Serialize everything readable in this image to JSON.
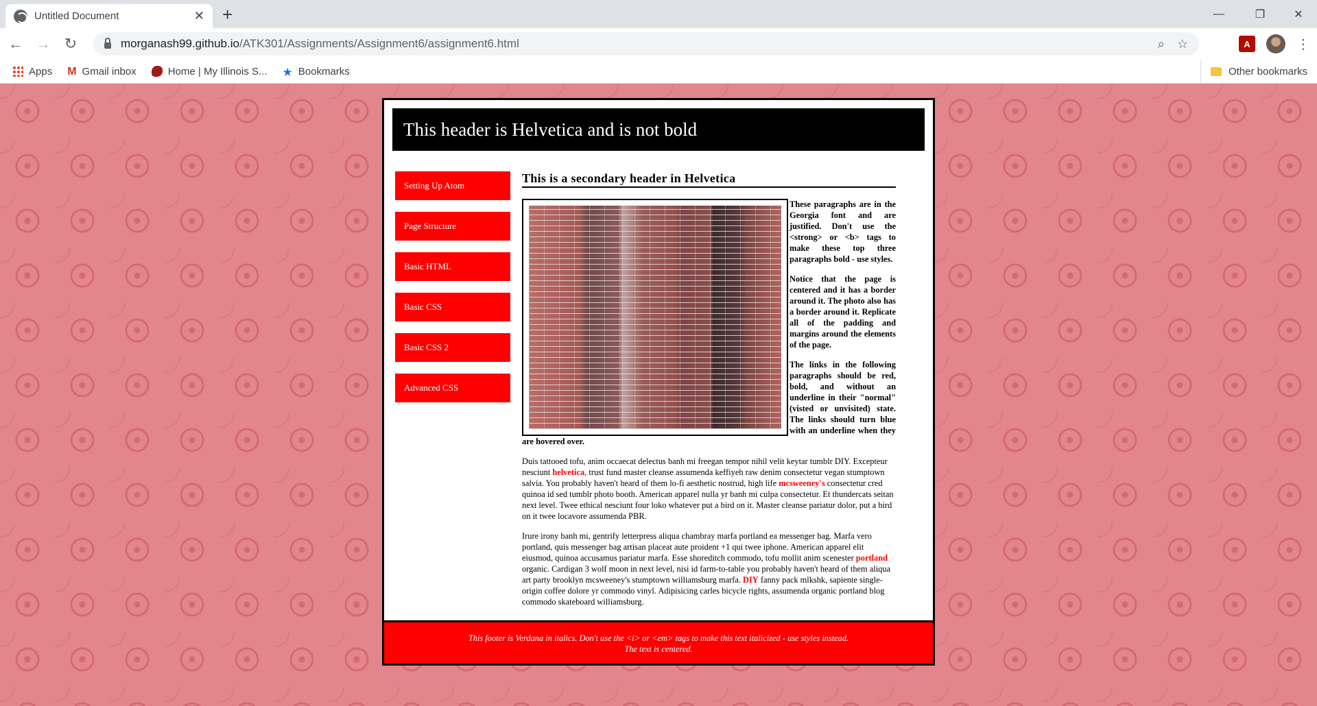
{
  "browser": {
    "tab_title": "Untitled Document",
    "tab_close": "✕",
    "new_tab": "+",
    "url_host": "morganash99.github.io",
    "url_path": "/ATK301/Assignments/Assignment6/assignment6.html",
    "window_minimize": "—",
    "window_restore": "❐",
    "window_close": "✕",
    "back": "←",
    "forward": "→",
    "reload": "↻",
    "zoom": "⌕",
    "star": "☆",
    "menu": "⋮",
    "pdf_label": "A"
  },
  "bookmarks": {
    "items": [
      "Apps",
      "Gmail inbox",
      "Home | My Illinois S...",
      "Bookmarks"
    ],
    "gmail_glyph": "M",
    "star_glyph": "★",
    "other": "Other bookmarks"
  },
  "page": {
    "header": "This header is Helvetica and is not bold",
    "nav": [
      "Setting Up Atom",
      "Page Structure",
      "Basic HTML",
      "Basic CSS",
      "Basic CSS 2",
      "Advanced CSS"
    ],
    "subheader": "This is a secondary header in Helvetica",
    "bold_paragraphs": [
      "These paragraphs are in the Georgia font and are justified. Don't use the <strong> or <b> tags to make these top three paragraphs bold - use styles.",
      "Notice that the page is centered and it has a border around it. The photo also has a border around it. Replicate all of the padding and margins around the elements of the page.",
      "The links in the following paragraphs should be red, bold, and without an underline in their \"normal\" (visted or unvisited) state. The links should turn blue with an underline when they are hovered over."
    ],
    "para1": {
      "t1": "Duis tattooed tofu, anim occaecat delectus banh mi freegan tempor nihil velit keytar tumblr DIY. Excepteur nesciunt ",
      "link1": "helvetica",
      "t2": ", trust fund master cleanse assumenda keffiyeh raw denim consectetur vegan stumptown salvia. You probably haven't heard of them lo-fi aesthetic nostrud, high life ",
      "link2": "mcsweeney's",
      "t3": " consectetur cred quinoa id sed tumblr photo booth. American apparel nulla yr banh mi culpa consectetur. Et thundercats seitan next level. Twee ethical nesciunt four loko whatever put a bird on it. Master cleanse pariatur dolor, put a bird on it twee locavore assumenda PBR."
    },
    "para2": {
      "t1": "Irure irony banh mi, gentrify letterpress aliqua chambray marfa portland ea messenger bag. Marfa vero portland, quis messenger bag artisan placeat aute proident +1 qui twee iphone. American apparel elit eiusmod, quinoa accusamus pariatur marfa. Esse shoreditch commodo, tofu mollit anim scenester ",
      "link1": "portland",
      "t2": " organic. Cardigan 3 wolf moon in next level, nisi id farm-to-table you probably haven't heard of them aliqua art party brooklyn mcsweeney's stumptown williamsburg marfa. ",
      "link2": "DIY",
      "t3": " fanny pack mlkshk, sapiente single-origin coffee dolore yr commodo vinyl. Adipisicing carles bicycle rights, assumenda organic portland blog commodo skateboard williamsburg."
    },
    "footer_line1": "This footer is Verdana in italics. Don't use the <i> or <em> tags to make this text italicized - use styles instead.",
    "footer_line2": "The text is centered."
  }
}
